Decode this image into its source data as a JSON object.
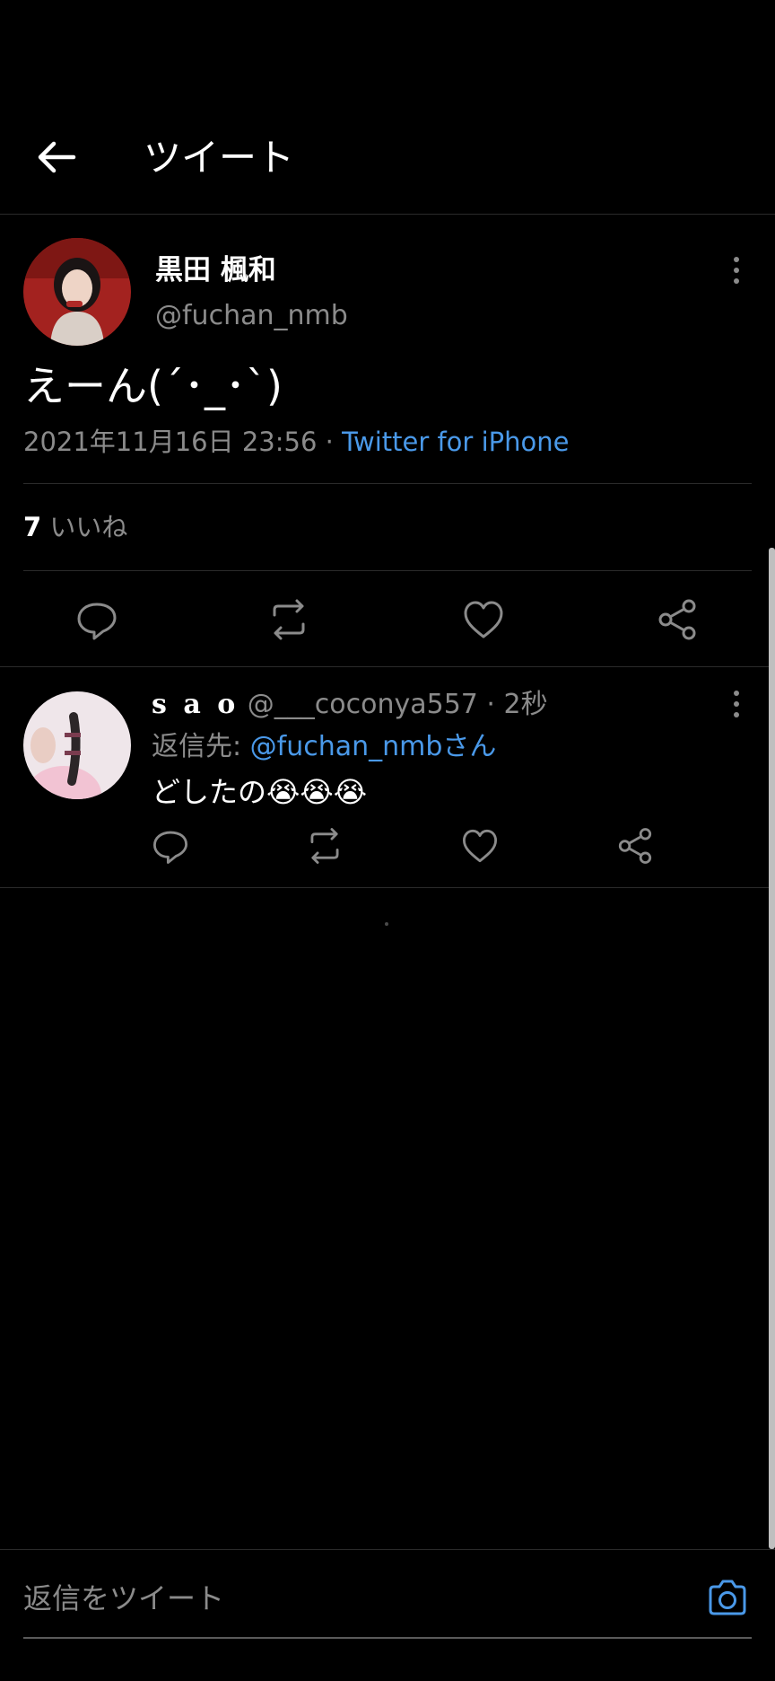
{
  "header": {
    "title": "ツイート",
    "back_icon": "arrow-left-icon"
  },
  "tweet": {
    "author_name": "黒田 楓和",
    "author_handle": "@fuchan_nmb",
    "text": "えーん(´･_･`)",
    "timestamp": "2021年11月16日 23:56 · ",
    "source": "Twitter for iPhone",
    "like_count": "7",
    "like_label": " いいね",
    "actions": [
      "reply-icon",
      "retweet-icon",
      "like-icon",
      "share-icon"
    ]
  },
  "reply": {
    "author_name": "s a o",
    "author_handle": " @___coconya557",
    "time": " · 2秒",
    "reply_to_prefix": "返信先: ",
    "reply_to_mention": "@fuchan_nmbさん",
    "text": "どしたの😭😭😭",
    "actions": [
      "reply-icon",
      "retweet-icon",
      "like-icon",
      "share-icon"
    ]
  },
  "composer": {
    "placeholder": "返信をツイート",
    "camera_icon": "camera-icon"
  },
  "colors": {
    "background": "#000000",
    "accent": "#4a99e9",
    "secondary_text": "#8b8b8b",
    "divider": "#2a2a2a"
  }
}
